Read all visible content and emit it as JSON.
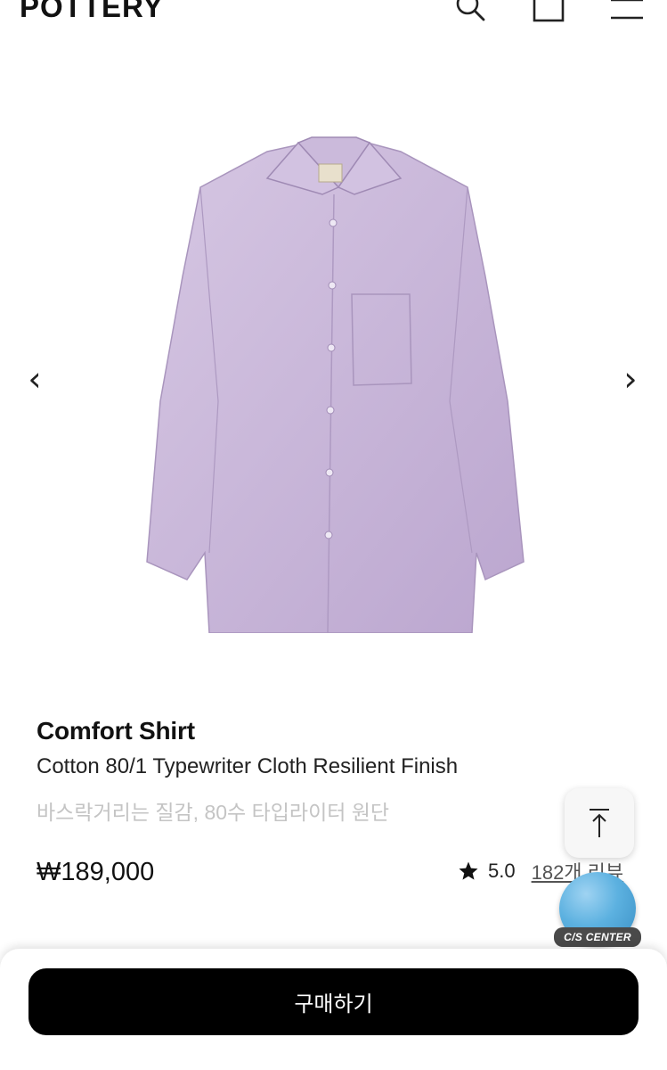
{
  "header": {
    "logo": "POTTERY",
    "icons": [
      "search-icon",
      "shopping-bag-icon",
      "menu-icon"
    ]
  },
  "gallery": {
    "prev_arrow": "‹",
    "next_arrow": "›",
    "image_subject": "lavender-shirt"
  },
  "product": {
    "name": "Comfort Shirt",
    "subtitle": "Cotton 80/1 Typewriter Cloth Resilient Finish",
    "description_ko": "바스락거리는 질감, 80수 타입라이터 원단",
    "price": "₩189,000",
    "rating": "5.0",
    "reviews": "182개 리뷰"
  },
  "floating": {
    "cs_center_label": "C/S CENTER"
  },
  "bottom": {
    "buy_label": "구매하기"
  },
  "colors": {
    "shirt": "#c8b6d8",
    "buy_button": "#000000",
    "cs_ball": "#5cb1e0"
  }
}
